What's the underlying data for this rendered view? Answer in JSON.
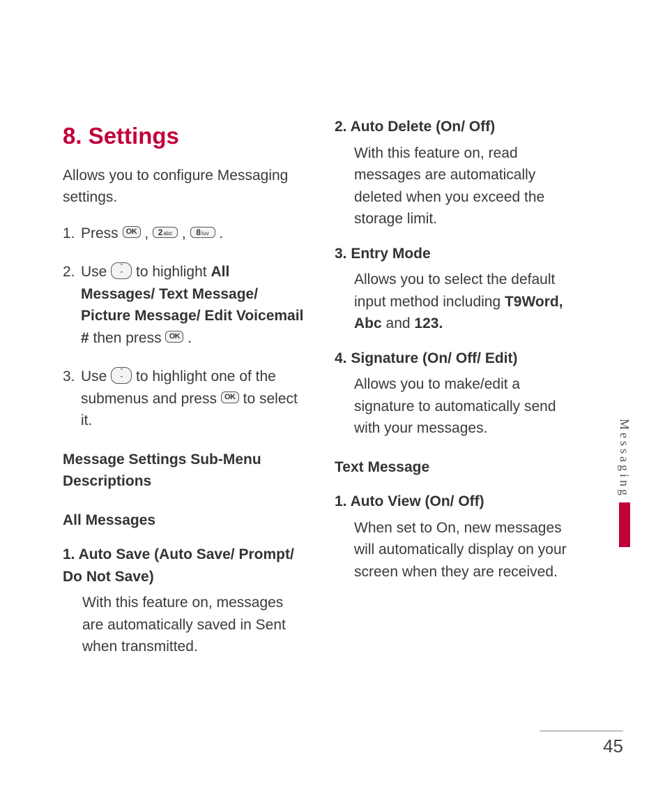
{
  "section_title": "8. Settings",
  "intro": "Allows you to configure Messaging settings.",
  "steps": {
    "s1": {
      "num": "1.",
      "a": "Press "
    },
    "s2": {
      "num": "2.",
      "a": "Use ",
      "b": " to highlight ",
      "bold": "All Messages/ Text Message/ Picture Message/ Edit Voicemail #",
      "c": " then press "
    },
    "s3": {
      "num": "3.",
      "a": "Use ",
      "b": " to highlight one of the submenus and press ",
      "c": " to select it."
    }
  },
  "keys": {
    "ok": "OK",
    "two": "2",
    "two_sub": "abc",
    "eight": "8",
    "eight_sub": "tuv"
  },
  "subhead_left": "Message Settings Sub-Menu Descriptions",
  "all_messages": {
    "heading": "All Messages",
    "i1": {
      "title": "1. Auto Save (Auto Save/ Prompt/ Do Not Save)",
      "body": "With this feature on, messages are automatically saved in Sent when transmitted."
    }
  },
  "right": {
    "i2": {
      "title": "2. Auto Delete (On/ Off)",
      "body": "With this feature on, read messages are automatically deleted when you exceed the storage limit."
    },
    "i3": {
      "title": "3. Entry Mode",
      "body_a": "Allows you to select the default input method including ",
      "bold": "T9Word, Abc",
      "body_b": " and ",
      "bold2": "123."
    },
    "i4": {
      "title": "4. Signature (On/ Off/ Edit)",
      "body": "Allows you to make/edit a signature to automatically send with your messages."
    },
    "text_msg": "Text Message",
    "i5": {
      "title": "1. Auto View (On/ Off)",
      "body": "When set to On, new messages will automatically display on your screen when they are received."
    }
  },
  "side_label": "Messaging",
  "page_number": "45"
}
